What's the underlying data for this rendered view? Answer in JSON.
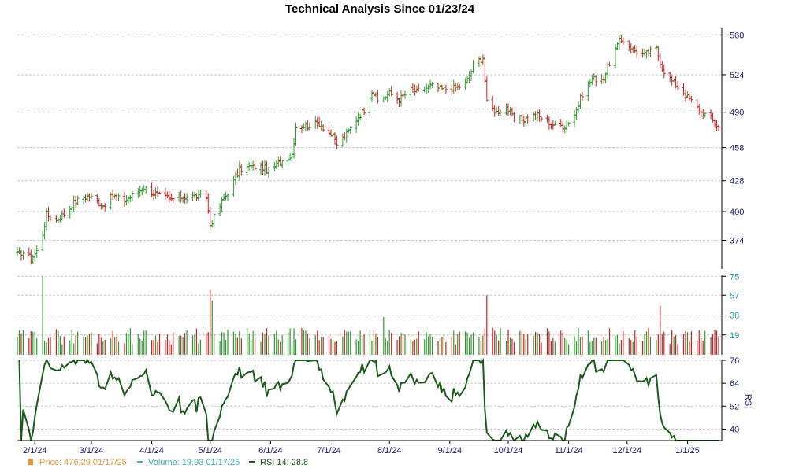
{
  "chart_data": {
    "type": "line",
    "title": "Technical Analysis Since 01/23/24",
    "x_ticks": [
      "2/1/24",
      "3/1/24",
      "4/1/24",
      "5/1/24",
      "6/1/24",
      "7/1/24",
      "8/1/24",
      "9/1/24",
      "10/1/24",
      "11/1/24",
      "12/1/24",
      "1/1/25"
    ],
    "price_panel": {
      "y_ticks": [
        374,
        400,
        428,
        458,
        490,
        524,
        560
      ],
      "ylim": [
        348,
        566
      ],
      "up_color": "#2e9a2e",
      "down_color": "#cc2222",
      "anchors": [
        [
          "2024-01-23",
          361
        ],
        [
          "2024-01-26",
          364
        ],
        [
          "2024-01-30",
          357
        ],
        [
          "2024-02-02",
          364
        ],
        [
          "2024-02-05",
          380
        ],
        [
          "2024-02-07",
          397
        ],
        [
          "2024-02-12",
          392
        ],
        [
          "2024-02-16",
          398
        ],
        [
          "2024-02-21",
          408
        ],
        [
          "2024-02-26",
          413
        ],
        [
          "2024-02-29",
          414
        ],
        [
          "2024-03-07",
          406
        ],
        [
          "2024-03-12",
          414
        ],
        [
          "2024-03-18",
          410
        ],
        [
          "2024-03-22",
          415
        ],
        [
          "2024-03-28",
          422
        ],
        [
          "2024-04-04",
          415
        ],
        [
          "2024-04-10",
          411
        ],
        [
          "2024-04-16",
          413
        ],
        [
          "2024-04-22",
          414
        ],
        [
          "2024-04-29",
          413
        ],
        [
          "2024-05-01",
          388
        ],
        [
          "2024-05-06",
          405
        ],
        [
          "2024-05-10",
          418
        ],
        [
          "2024-05-16",
          438
        ],
        [
          "2024-05-22",
          441
        ],
        [
          "2024-05-28",
          440
        ],
        [
          "2024-05-31",
          437
        ],
        [
          "2024-06-06",
          445
        ],
        [
          "2024-06-12",
          452
        ],
        [
          "2024-06-14",
          477
        ],
        [
          "2024-06-20",
          478
        ],
        [
          "2024-06-26",
          480
        ],
        [
          "2024-07-02",
          470
        ],
        [
          "2024-07-05",
          461
        ],
        [
          "2024-07-10",
          470
        ],
        [
          "2024-07-16",
          486
        ],
        [
          "2024-07-19",
          492
        ],
        [
          "2024-07-23",
          510
        ],
        [
          "2024-07-26",
          500
        ],
        [
          "2024-08-01",
          507
        ],
        [
          "2024-08-06",
          502
        ],
        [
          "2024-08-12",
          510
        ],
        [
          "2024-08-16",
          508
        ],
        [
          "2024-08-22",
          514
        ],
        [
          "2024-08-28",
          511
        ],
        [
          "2024-09-03",
          512
        ],
        [
          "2024-09-09",
          515
        ],
        [
          "2024-09-13",
          532
        ],
        [
          "2024-09-18",
          540
        ],
        [
          "2024-09-20",
          498
        ],
        [
          "2024-09-25",
          490
        ],
        [
          "2024-09-30",
          495
        ],
        [
          "2024-10-04",
          483
        ],
        [
          "2024-10-10",
          484
        ],
        [
          "2024-10-15",
          488
        ],
        [
          "2024-10-21",
          482
        ],
        [
          "2024-10-25",
          478
        ],
        [
          "2024-10-30",
          478
        ],
        [
          "2024-11-04",
          488
        ],
        [
          "2024-11-08",
          507
        ],
        [
          "2024-11-13",
          520
        ],
        [
          "2024-11-19",
          521
        ],
        [
          "2024-11-22",
          535
        ],
        [
          "2024-11-27",
          554
        ],
        [
          "2024-11-29",
          555
        ],
        [
          "2024-12-04",
          547
        ],
        [
          "2024-12-10",
          542
        ],
        [
          "2024-12-16",
          548
        ],
        [
          "2024-12-19",
          530
        ],
        [
          "2024-12-24",
          518
        ],
        [
          "2024-12-30",
          508
        ],
        [
          "2025-01-03",
          500
        ],
        [
          "2025-01-08",
          490
        ],
        [
          "2025-01-13",
          485
        ],
        [
          "2025-01-17",
          476.29
        ]
      ]
    },
    "volume_panel": {
      "y_ticks": [
        19,
        38,
        57,
        75
      ],
      "ylim": [
        0,
        76
      ],
      "spikes": [
        [
          "2024-02-05",
          75
        ],
        [
          "2024-05-01",
          62
        ],
        [
          "2024-05-02",
          52
        ],
        [
          "2024-07-29",
          36
        ],
        [
          "2024-09-20",
          57
        ],
        [
          "2024-12-18",
          47
        ]
      ],
      "baseline_range": [
        12,
        26
      ]
    },
    "rsi_panel": {
      "label": "RSI",
      "y_ticks": [
        40,
        52,
        64,
        76
      ],
      "ylim": [
        34,
        76
      ],
      "line_color": "#1a5a1a"
    },
    "legend": [
      {
        "label": "Price: 476.29  01/17/25",
        "color": "#e8953a",
        "marker": "square"
      },
      {
        "label": "Volume: 19.93  01/17/25",
        "color": "#3ab0b8",
        "marker": "dash"
      },
      {
        "label": "RSI 14: 28.8",
        "color": "#1a5a1a",
        "marker": "line"
      }
    ]
  }
}
